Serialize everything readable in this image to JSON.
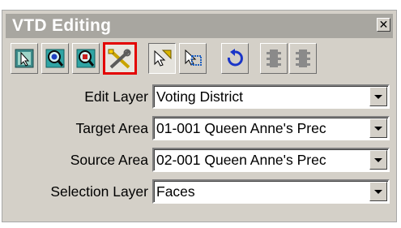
{
  "window": {
    "title": "VTD Editing",
    "close_glyph": "✕"
  },
  "toolbar": {
    "buttons": [
      {
        "name": "select-icon",
        "state": "normal"
      },
      {
        "name": "zoom-in-icon",
        "state": "normal"
      },
      {
        "name": "zoom-out-icon",
        "state": "normal"
      },
      {
        "name": "edit-tools-icon",
        "state": "selected"
      },
      {
        "name": "identify-pointer-icon",
        "state": "pressed"
      },
      {
        "name": "select-area-pointer-icon",
        "state": "normal"
      },
      {
        "name": "undo-icon",
        "state": "normal"
      },
      {
        "name": "traffic-light-icon",
        "state": "disabled"
      },
      {
        "name": "traffic-light-icon",
        "state": "disabled"
      }
    ],
    "highlight_color": "#e30000"
  },
  "fields": {
    "edit_layer": {
      "label": "Edit Layer",
      "value": "Voting District"
    },
    "target_area": {
      "label": "Target Area",
      "value": "01-001 Queen Anne's Prec"
    },
    "source_area": {
      "label": "Source Area",
      "value": "02-001 Queen Anne's Prec"
    },
    "selection_layer": {
      "label": "Selection Layer",
      "value": "Faces"
    }
  }
}
